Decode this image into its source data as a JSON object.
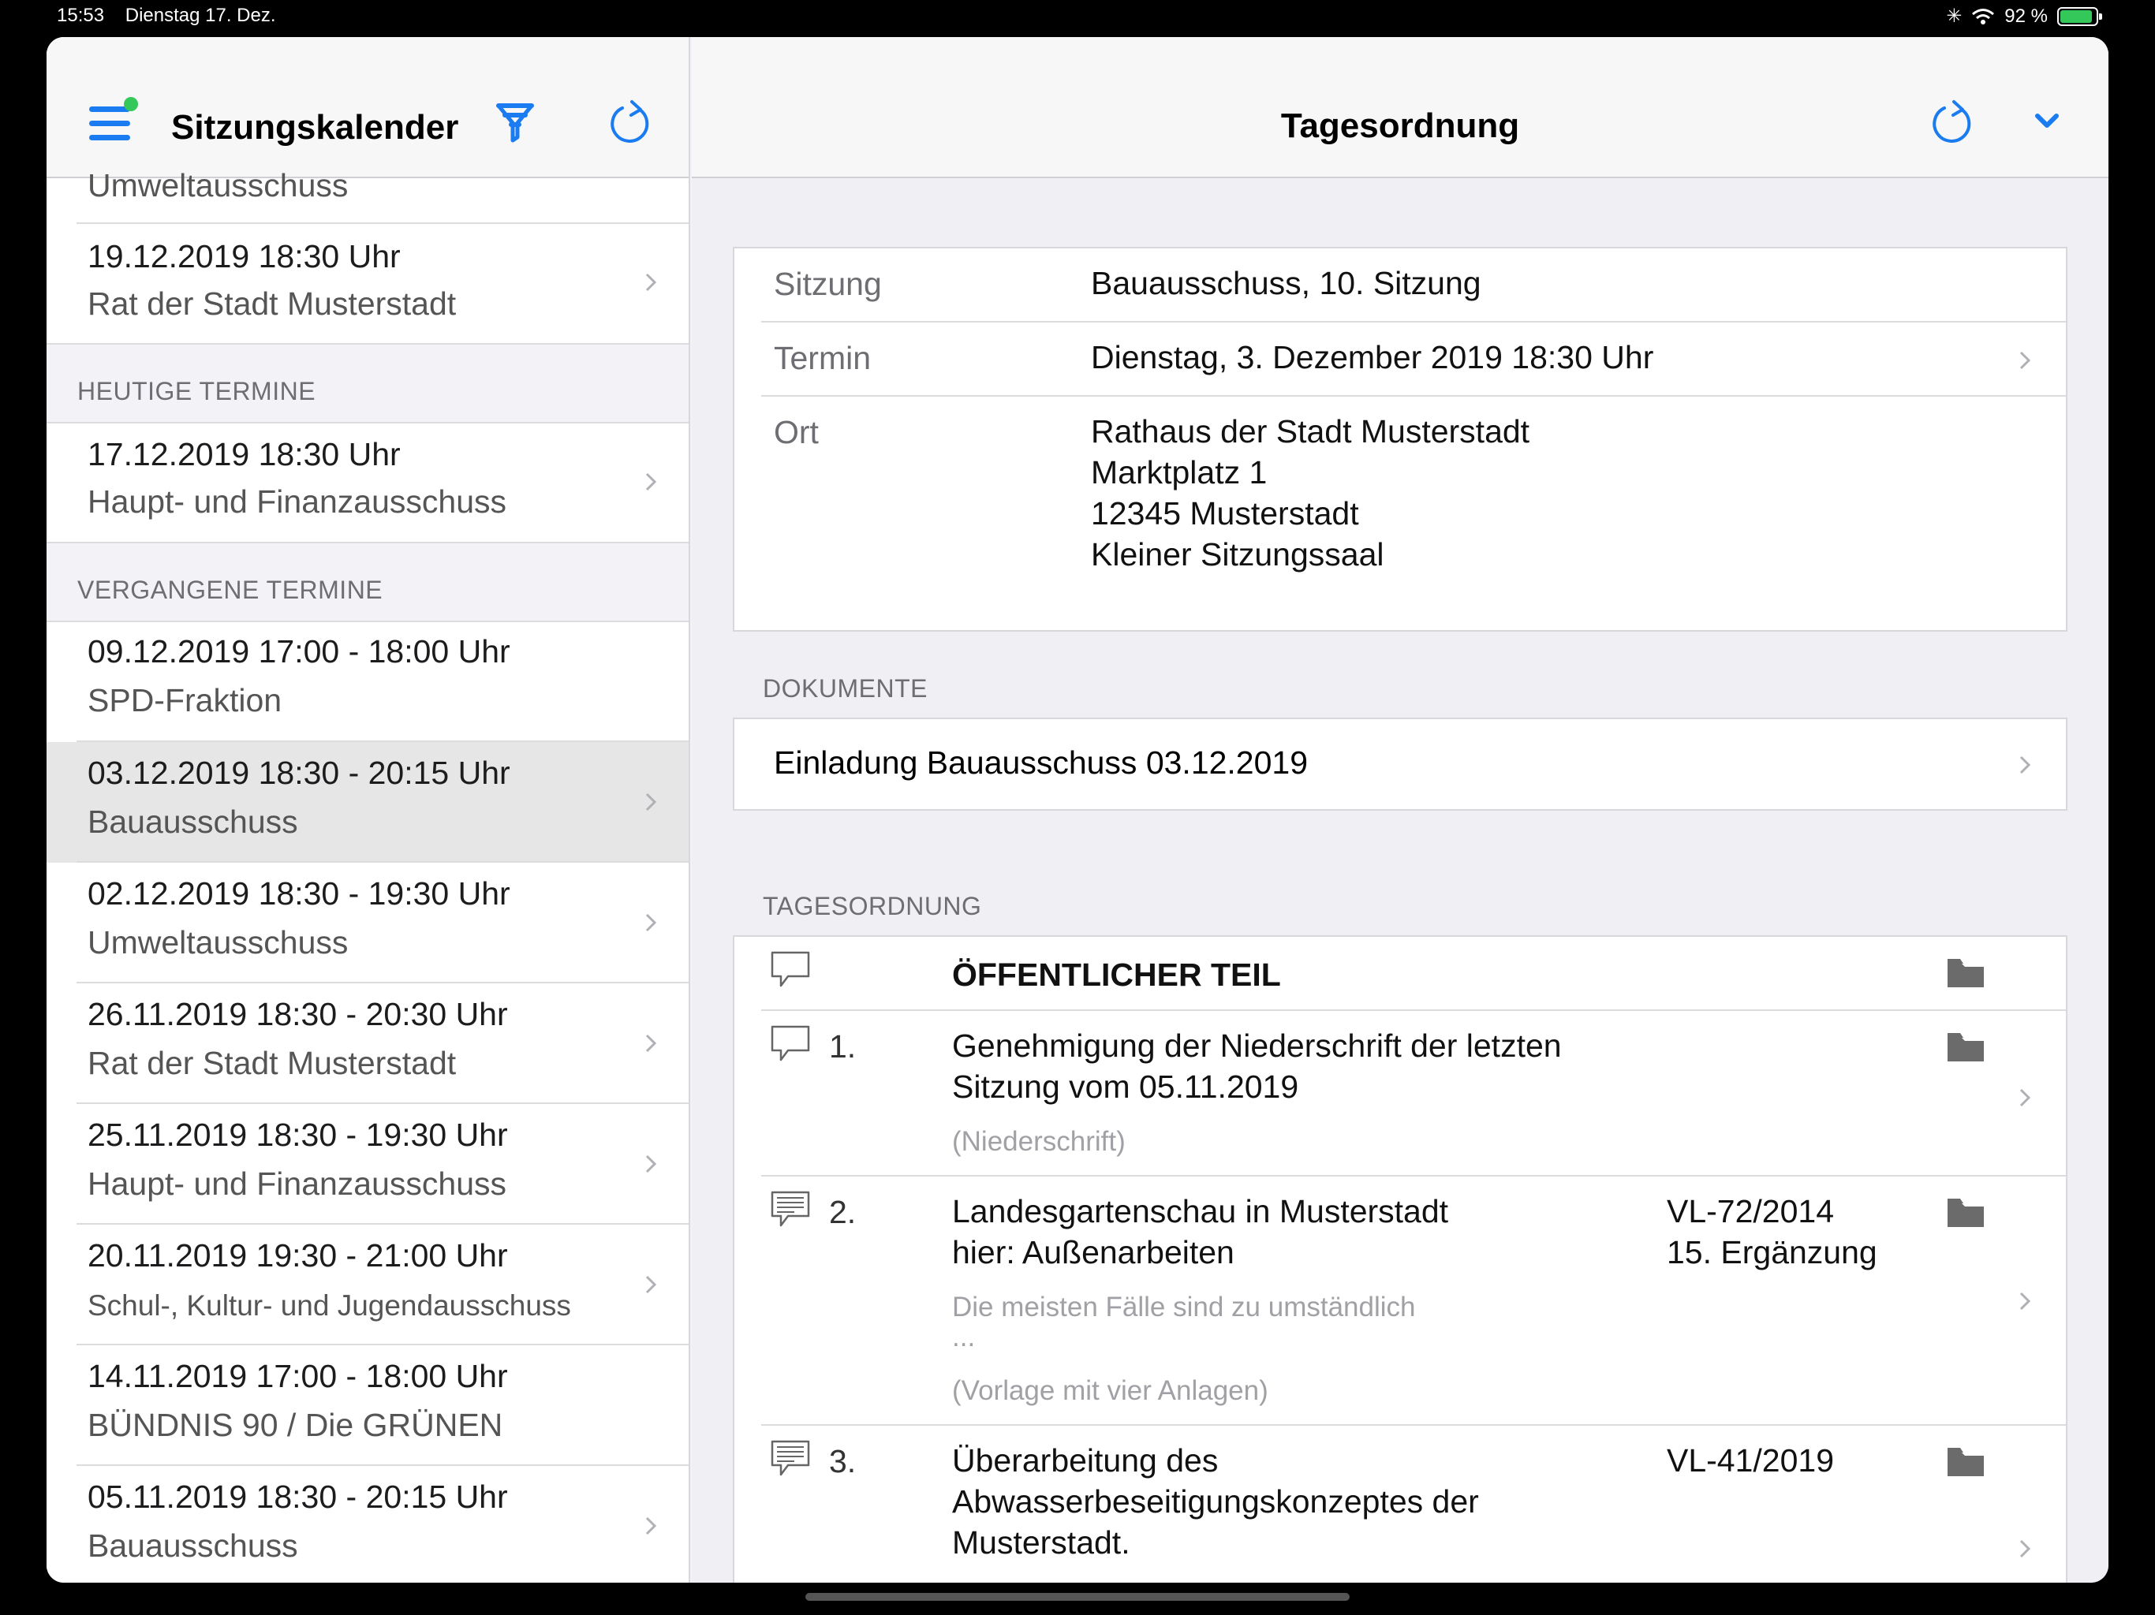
{
  "status_bar": {
    "time": "15:53",
    "date": "Dienstag 17. Dez.",
    "battery": "92 %",
    "battery_level": 0.92
  },
  "master": {
    "title": "Sitzungskalender",
    "icons": [
      "menu-icon",
      "filter-icon",
      "refresh-icon"
    ],
    "partial_row": {
      "line2": "Umweltausschuss"
    },
    "upcoming": [
      {
        "line1": "19.12.2019 18:30 Uhr",
        "line2": "Rat der Stadt Musterstadt"
      }
    ],
    "today_header": "HEUTIGE TERMINE",
    "today": [
      {
        "line1": "17.12.2019 18:30 Uhr",
        "line2": "Haupt- und Finanzausschuss"
      }
    ],
    "past_header": "VERGANGENE TERMINE",
    "past": [
      {
        "line1": "09.12.2019 17:00 -  18:00 Uhr",
        "line2": "SPD-Fraktion"
      },
      {
        "line1": "03.12.2019 18:30 -  20:15 Uhr",
        "line2": "Bauausschuss"
      },
      {
        "line1": "02.12.2019 18:30 -  19:30 Uhr",
        "line2": "Umweltausschuss"
      },
      {
        "line1": "26.11.2019 18:30 -  20:30 Uhr",
        "line2": "Rat der Stadt Musterstadt"
      },
      {
        "line1": "25.11.2019 18:30 -  19:30 Uhr",
        "line2": "Haupt- und Finanzausschuss"
      },
      {
        "line1": "20.11.2019 19:30 -  21:00 Uhr",
        "line2": "Schul-, Kultur- und Jugendausschuss"
      },
      {
        "line1": "14.11.2019 17:00 -  18:00 Uhr",
        "line2": "BÜNDNIS 90 / Die GRÜNEN"
      },
      {
        "line1": "05.11.2019 18:30 -  20:15 Uhr",
        "line2": "Bauausschuss"
      }
    ]
  },
  "detail": {
    "title": "Tagesordnung",
    "icons": [
      "refresh-icon",
      "chevron-down-icon"
    ],
    "info": {
      "sitzung_label": "Sitzung",
      "sitzung_value": "Bauausschuss, 10. Sitzung",
      "termin_label": "Termin",
      "termin_value": "Dienstag, 3. Dezember 2019 18:30 Uhr",
      "ort_label": "Ort",
      "ort_lines": [
        "Rathaus der Stadt Musterstadt",
        "Marktplatz 1",
        "12345 Musterstadt",
        "Kleiner Sitzungssaal"
      ]
    },
    "documents_header": "DOKUMENTE",
    "documents": [
      "Einladung Bauausschuss 03.12.2019"
    ],
    "agenda_header": "TAGESORDNUNG",
    "agenda": [
      {
        "num": "",
        "title": [
          "ÖFFENTLICHER TEIL"
        ],
        "ref": [],
        "notes": []
      },
      {
        "num": "1.",
        "title": [
          "Genehmigung der Niederschrift der letzten",
          "Sitzung vom 05.11.2019"
        ],
        "ref": [],
        "notes": [
          "(Niederschrift)"
        ]
      },
      {
        "num": "2.",
        "title": [
          "Landesgartenschau in Musterstadt",
          "hier: Außenarbeiten"
        ],
        "ref": [
          "VL-72/2014",
          "15. Ergänzung"
        ],
        "notes": [
          "Die meisten Fälle sind zu umständlich",
          "...",
          "(Vorlage mit vier Anlagen)"
        ]
      },
      {
        "num": "3.",
        "title": [
          "Überarbeitung des",
          "Abwasserbeseitigungskonzeptes der",
          "Musterstadt."
        ],
        "ref": [
          "VL-41/2019"
        ],
        "notes": []
      }
    ]
  },
  "colors": {
    "accent": "#1a7cf0",
    "badge": "#34c759",
    "selected_row": "#e6e6e6"
  }
}
